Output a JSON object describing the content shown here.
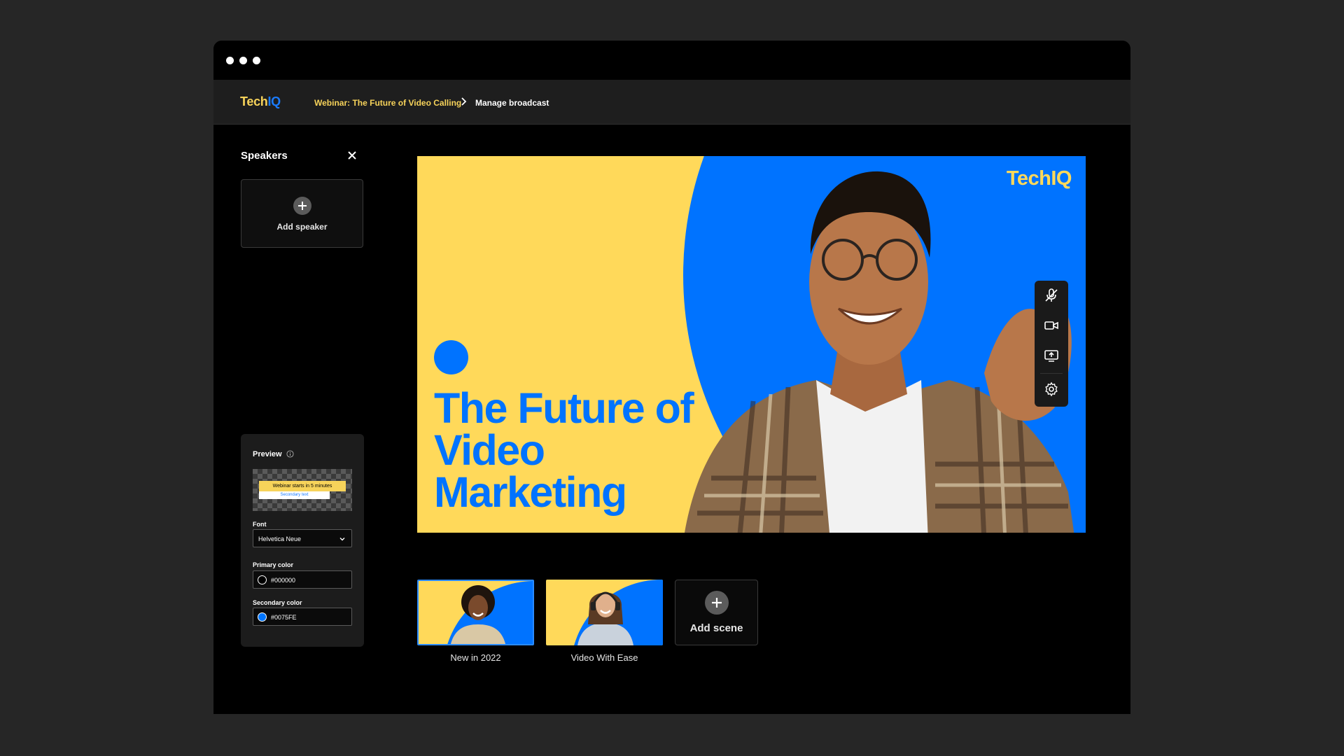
{
  "header": {
    "logo_part1": "Tech",
    "logo_part2": "IQ",
    "breadcrumb_parent": "Webinar: The Future of Video Calling",
    "breadcrumb_current": "Manage broadcast"
  },
  "sidebar": {
    "title": "Speakers",
    "add_speaker_label": "Add speaker"
  },
  "preview": {
    "title": "Preview",
    "primary_text": "Webinar starts in 5 minutes",
    "secondary_text": "Secondary text",
    "font_label": "Font",
    "font_value": "Helvetica Neue",
    "primary_color_label": "Primary color",
    "primary_color_value": "#000000",
    "secondary_color_label": "Secondary color",
    "secondary_color_value": "#0075FE"
  },
  "stage": {
    "title": "The Future of Video Marketing",
    "logo": "TechIQ"
  },
  "scenes": [
    {
      "label": "New in 2022",
      "selected": true
    },
    {
      "label": "Video With Ease",
      "selected": false
    }
  ],
  "add_scene_label": "Add scene",
  "colors": {
    "brand_yellow": "#ffd95a",
    "brand_blue": "#0073ff",
    "selection_blue": "#2a8bff"
  },
  "icons": {
    "controls": [
      "mic-off-icon",
      "camera-icon",
      "screen-share-icon",
      "settings-icon"
    ],
    "sidebar_close": "close-icon"
  }
}
